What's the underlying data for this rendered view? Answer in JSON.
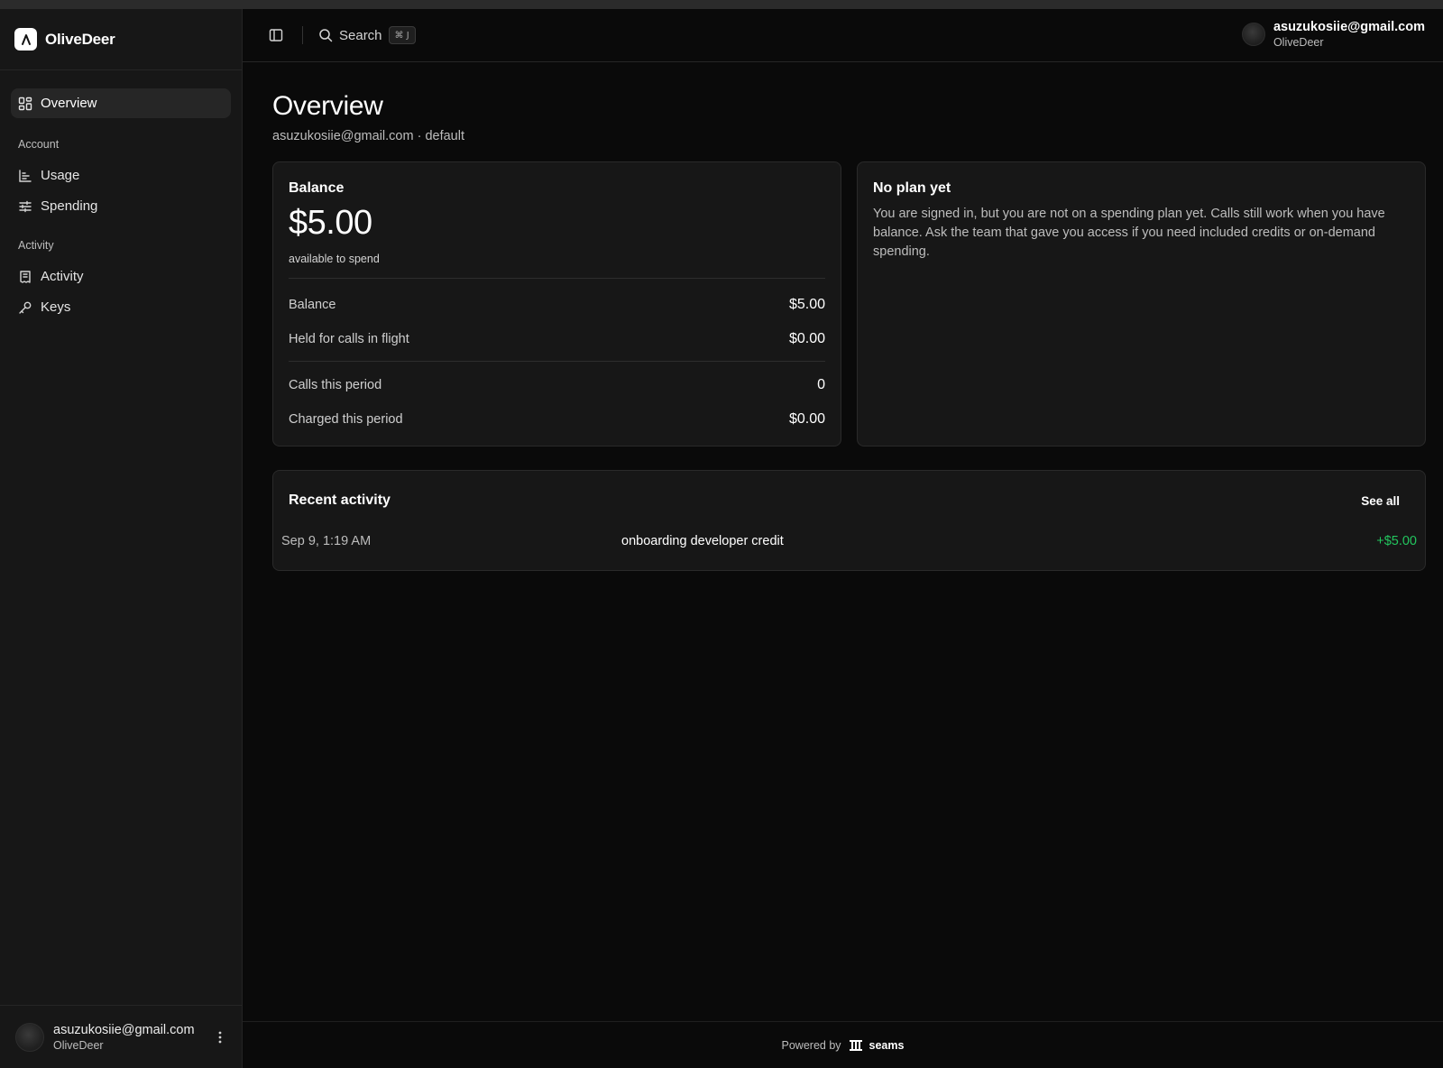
{
  "brand": {
    "name": "OliveDeer"
  },
  "sidebar": {
    "items": [
      {
        "label": "Overview"
      }
    ],
    "sections": [
      {
        "title": "Account",
        "items": [
          {
            "label": "Usage"
          },
          {
            "label": "Spending"
          }
        ]
      },
      {
        "title": "Activity",
        "items": [
          {
            "label": "Activity"
          },
          {
            "label": "Keys"
          }
        ]
      }
    ],
    "footer": {
      "email": "asuzukosiie@gmail.com",
      "org": "OliveDeer"
    }
  },
  "topbar": {
    "search_label": "Search",
    "search_shortcut": "⌘ J",
    "user": {
      "email": "asuzukosiie@gmail.com",
      "org": "OliveDeer"
    }
  },
  "page": {
    "title": "Overview",
    "subtitle": "asuzukosiie@gmail.com · default"
  },
  "balance_card": {
    "title": "Balance",
    "amount": "$5.00",
    "note": "available to spend",
    "rows": [
      {
        "label": "Balance",
        "value": "$5.00"
      },
      {
        "label": "Held for calls in flight",
        "value": "$0.00"
      },
      {
        "label": "Calls this period",
        "value": "0"
      },
      {
        "label": "Charged this period",
        "value": "$0.00"
      }
    ]
  },
  "plan_card": {
    "title": "No plan yet",
    "text": "You are signed in, but you are not on a spending plan yet. Calls still work when you have balance. Ask the team that gave you access if you need included credits or on-demand spending."
  },
  "recent_activity": {
    "title": "Recent activity",
    "see_all": "See all",
    "entries": [
      {
        "date": "Sep 9, 1:19 AM",
        "description": "onboarding developer credit",
        "amount": "+$5.00"
      }
    ]
  },
  "footer": {
    "powered_by": "Powered by",
    "vendor": "seams"
  },
  "colors": {
    "background": "#0a0a0a",
    "sidebar": "#171717",
    "positive": "#22c55e"
  }
}
